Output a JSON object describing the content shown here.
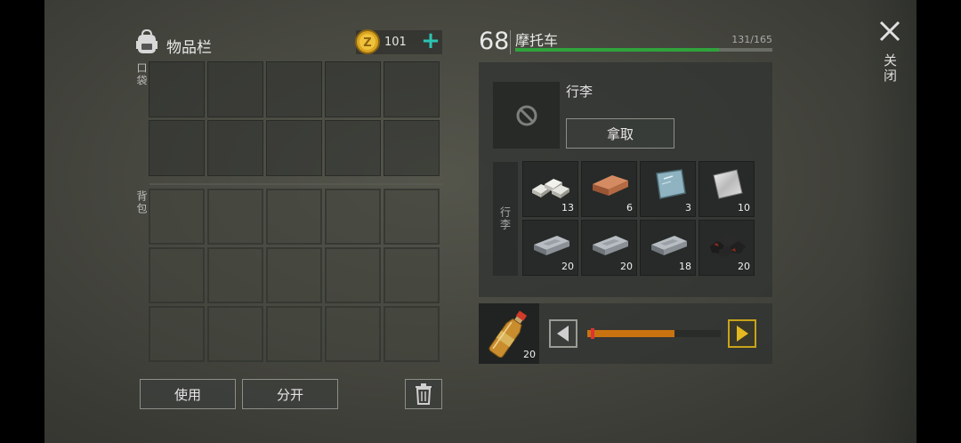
{
  "inventory": {
    "title": "物品栏",
    "coins": "101",
    "pocket_label": "口袋",
    "backpack_label": "背包",
    "pocket_slots": 10,
    "backpack_slots": 15
  },
  "actions": {
    "use_label": "使用",
    "split_label": "分开"
  },
  "vehicle": {
    "level": "68",
    "name": "摩托车",
    "hp": "131/165",
    "hp_fraction": 0.794
  },
  "storage": {
    "title": "行李",
    "take_label": "拿取",
    "side_label": "行李",
    "items": [
      {
        "icon": "silver-ingots-icon",
        "qty": "13"
      },
      {
        "icon": "copper-ingot-icon",
        "qty": "6"
      },
      {
        "icon": "glass-sheet-icon",
        "qty": "3"
      },
      {
        "icon": "metal-sheet-icon",
        "qty": "10"
      },
      {
        "icon": "iron-bar-icon",
        "qty": "20"
      },
      {
        "icon": "iron-bar-icon",
        "qty": "20"
      },
      {
        "icon": "iron-bar-icon",
        "qty": "18"
      },
      {
        "icon": "coal-icon",
        "qty": "20"
      }
    ]
  },
  "transfer": {
    "item_icon": "water-bottle-icon",
    "qty": "20",
    "slider_fraction": 0.65
  },
  "close": {
    "label": "关闭"
  },
  "colors": {
    "hp_bar": "#2fa33c",
    "coin_plus": "#2bc4b4",
    "slider_fill": "#c8730f",
    "arrow_right": "#c9a41a"
  }
}
